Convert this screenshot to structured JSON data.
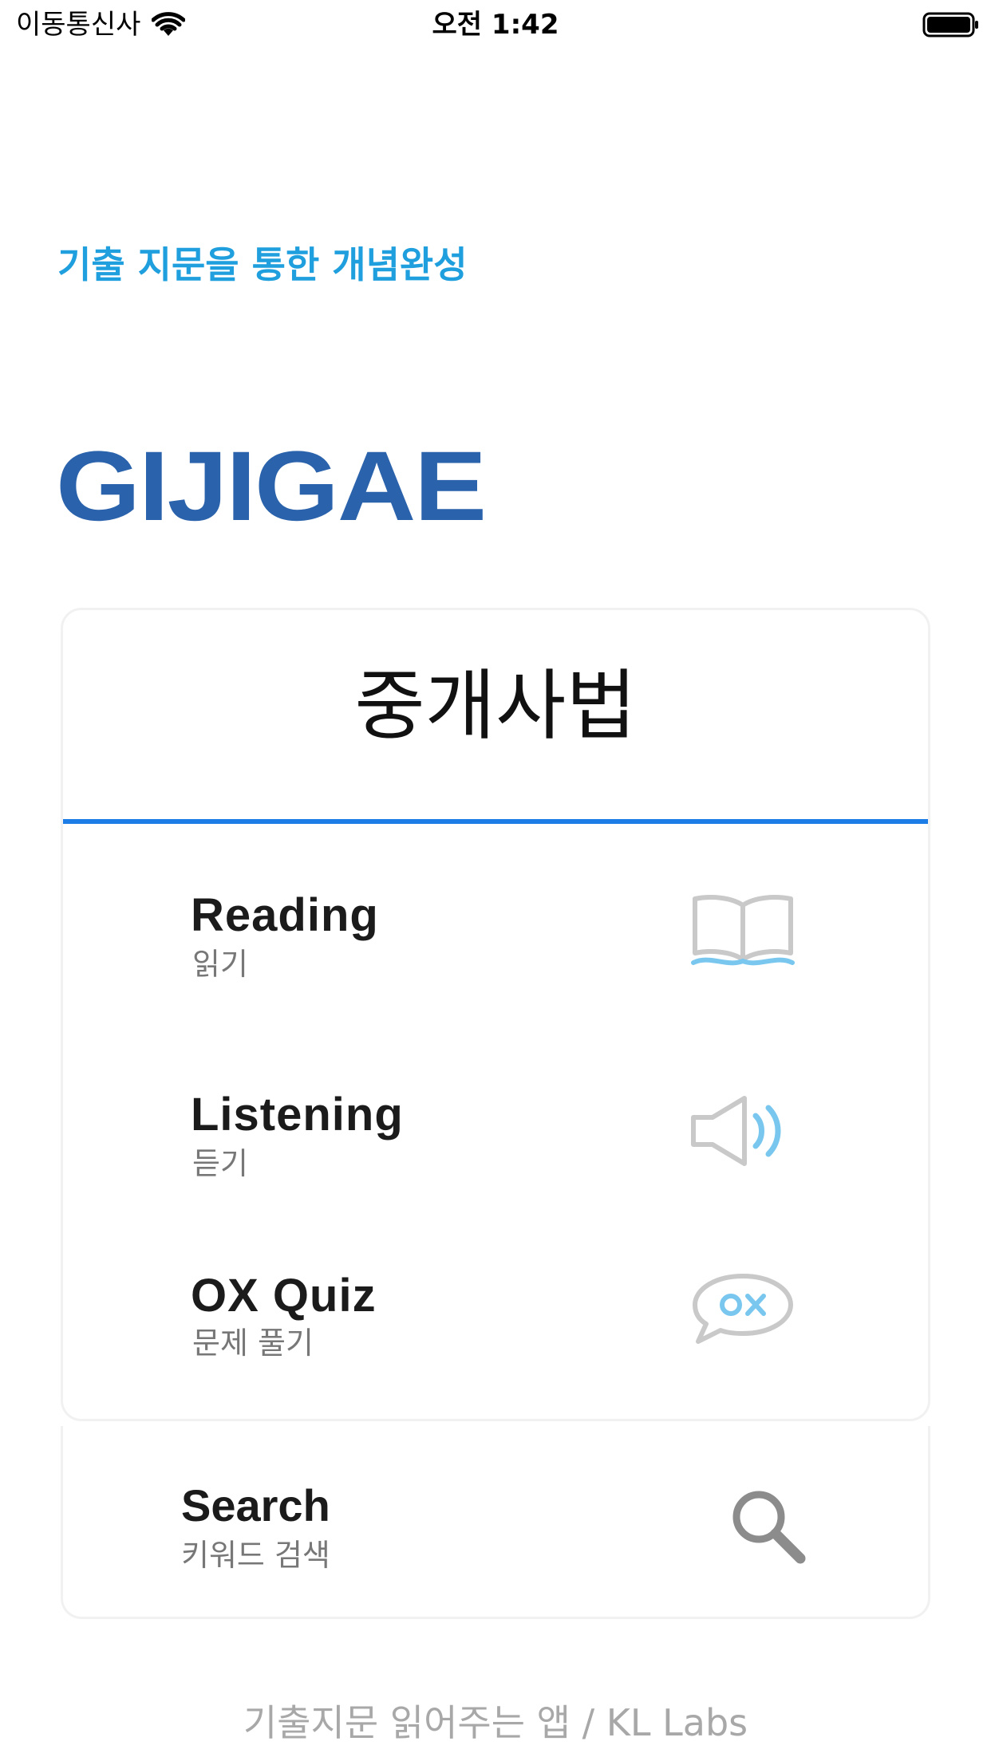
{
  "status_bar": {
    "carrier": "이동통신사",
    "time": "오전 1:42"
  },
  "header": {
    "tagline": "기출 지문을 통한 개념완성",
    "logo": "GIJIGAE"
  },
  "card": {
    "subject": "중개사법",
    "items": [
      {
        "label": "Reading",
        "sub": "읽기",
        "icon": "book-icon"
      },
      {
        "label": "Listening",
        "sub": "듣기",
        "icon": "speaker-icon"
      },
      {
        "label": "OX Quiz",
        "sub": "문제 풀기",
        "icon": "ox-bubble-icon"
      }
    ]
  },
  "search": {
    "label": "Search",
    "sub": "키워드 검색",
    "icon": "search-icon"
  },
  "footer": {
    "text": "기출지문 읽어주는 앱 / KL Labs"
  },
  "colors": {
    "tagline": "#1f9fdd",
    "logo": "#2a62ab",
    "divider": "#1d7de6",
    "icon_accent": "#79c7ef",
    "icon_gray": "#c9c9c9",
    "footer": "#a8a8a8"
  }
}
